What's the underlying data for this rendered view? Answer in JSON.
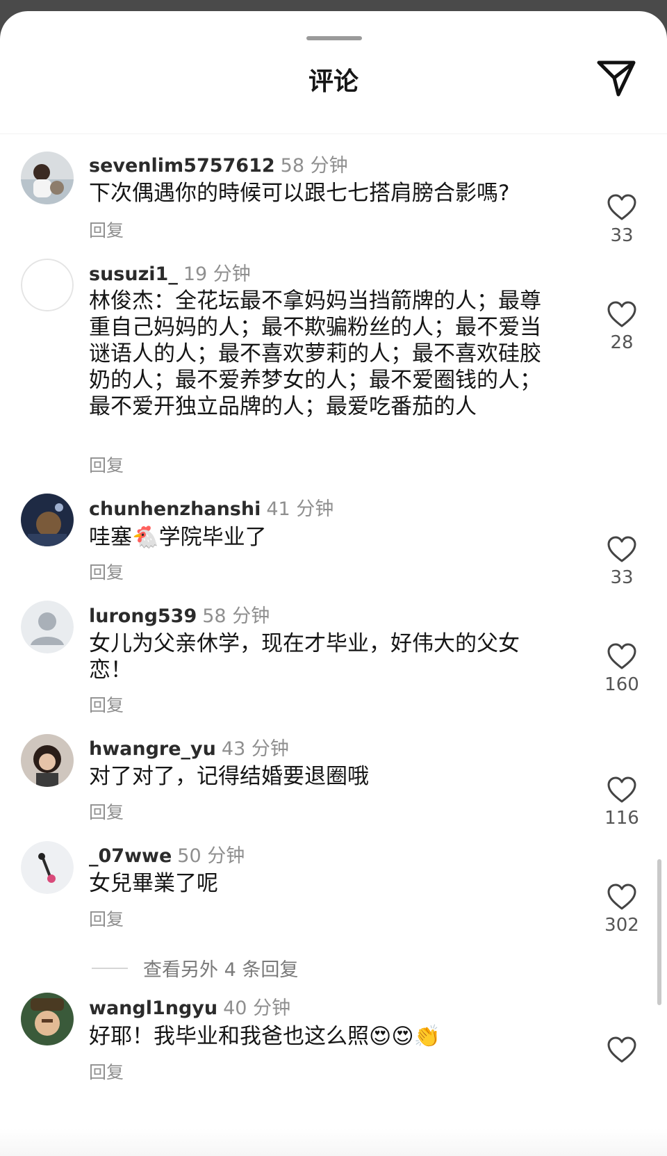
{
  "header": {
    "title": "评论"
  },
  "comments": [
    {
      "user": "sevenlim5757612",
      "time": "58 分钟",
      "text": "下次偶遇你的時候可以跟七七搭肩膀合影嗎?",
      "reply": "回复",
      "likes": "33"
    },
    {
      "user": "susuzi1_",
      "time": "19 分钟",
      "text": "林俊杰：全花坛最不拿妈妈当挡箭牌的人；最尊重自己妈妈的人；最不欺骗粉丝的人；最不爱当谜语人的人；最不喜欢萝莉的人；最不喜欢硅胶奶的人；最不爱养梦女的人；最不爱圈钱的人；最不爱开独立品牌的人；最爱吃番茄的人",
      "reply": "回复",
      "likes": "28"
    },
    {
      "user": "chunhenzhanshi",
      "time": "41 分钟",
      "text_a": "哇塞",
      "emoji": "🐔",
      "text_b": "学院毕业了",
      "reply": "回复",
      "likes": "33"
    },
    {
      "user": "lurong539",
      "time": "58 分钟",
      "text": "女儿为父亲休学，现在才毕业，好伟大的父女恋！",
      "reply": "回复",
      "likes": "160"
    },
    {
      "user": "hwangre_yu",
      "time": "43 分钟",
      "text": "对了对了，记得结婚要退圈哦",
      "reply": "回复",
      "likes": "116"
    },
    {
      "user": "_07wwe",
      "time": "50 分钟",
      "text": "女兒畢業了呢",
      "reply": "回复",
      "likes": "302"
    },
    {
      "user": "wangl1ngyu",
      "time": "40 分钟",
      "text": "好耶！我毕业和我爸也这么照",
      "emojis": "😍😍👏",
      "reply": "回复",
      "likes": ""
    }
  ],
  "more_replies": "查看另外 4 条回复",
  "icons": {
    "share": "send-icon",
    "like": "heart-outline-icon"
  },
  "colors": {
    "sheet": "#ffffff",
    "backdrop": "#4a4a4a",
    "muted": "#8f8f8f"
  }
}
